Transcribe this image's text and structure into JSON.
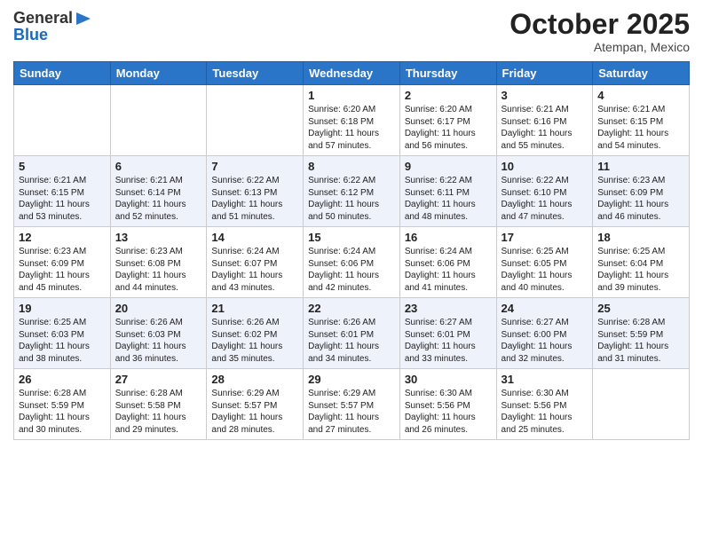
{
  "header": {
    "logo_general": "General",
    "logo_blue": "Blue",
    "month": "October 2025",
    "location": "Atempan, Mexico"
  },
  "days_of_week": [
    "Sunday",
    "Monday",
    "Tuesday",
    "Wednesday",
    "Thursday",
    "Friday",
    "Saturday"
  ],
  "weeks": [
    [
      {
        "num": "",
        "info": ""
      },
      {
        "num": "",
        "info": ""
      },
      {
        "num": "",
        "info": ""
      },
      {
        "num": "1",
        "info": "Sunrise: 6:20 AM\nSunset: 6:18 PM\nDaylight: 11 hours\nand 57 minutes."
      },
      {
        "num": "2",
        "info": "Sunrise: 6:20 AM\nSunset: 6:17 PM\nDaylight: 11 hours\nand 56 minutes."
      },
      {
        "num": "3",
        "info": "Sunrise: 6:21 AM\nSunset: 6:16 PM\nDaylight: 11 hours\nand 55 minutes."
      },
      {
        "num": "4",
        "info": "Sunrise: 6:21 AM\nSunset: 6:15 PM\nDaylight: 11 hours\nand 54 minutes."
      }
    ],
    [
      {
        "num": "5",
        "info": "Sunrise: 6:21 AM\nSunset: 6:15 PM\nDaylight: 11 hours\nand 53 minutes."
      },
      {
        "num": "6",
        "info": "Sunrise: 6:21 AM\nSunset: 6:14 PM\nDaylight: 11 hours\nand 52 minutes."
      },
      {
        "num": "7",
        "info": "Sunrise: 6:22 AM\nSunset: 6:13 PM\nDaylight: 11 hours\nand 51 minutes."
      },
      {
        "num": "8",
        "info": "Sunrise: 6:22 AM\nSunset: 6:12 PM\nDaylight: 11 hours\nand 50 minutes."
      },
      {
        "num": "9",
        "info": "Sunrise: 6:22 AM\nSunset: 6:11 PM\nDaylight: 11 hours\nand 48 minutes."
      },
      {
        "num": "10",
        "info": "Sunrise: 6:22 AM\nSunset: 6:10 PM\nDaylight: 11 hours\nand 47 minutes."
      },
      {
        "num": "11",
        "info": "Sunrise: 6:23 AM\nSunset: 6:09 PM\nDaylight: 11 hours\nand 46 minutes."
      }
    ],
    [
      {
        "num": "12",
        "info": "Sunrise: 6:23 AM\nSunset: 6:09 PM\nDaylight: 11 hours\nand 45 minutes."
      },
      {
        "num": "13",
        "info": "Sunrise: 6:23 AM\nSunset: 6:08 PM\nDaylight: 11 hours\nand 44 minutes."
      },
      {
        "num": "14",
        "info": "Sunrise: 6:24 AM\nSunset: 6:07 PM\nDaylight: 11 hours\nand 43 minutes."
      },
      {
        "num": "15",
        "info": "Sunrise: 6:24 AM\nSunset: 6:06 PM\nDaylight: 11 hours\nand 42 minutes."
      },
      {
        "num": "16",
        "info": "Sunrise: 6:24 AM\nSunset: 6:06 PM\nDaylight: 11 hours\nand 41 minutes."
      },
      {
        "num": "17",
        "info": "Sunrise: 6:25 AM\nSunset: 6:05 PM\nDaylight: 11 hours\nand 40 minutes."
      },
      {
        "num": "18",
        "info": "Sunrise: 6:25 AM\nSunset: 6:04 PM\nDaylight: 11 hours\nand 39 minutes."
      }
    ],
    [
      {
        "num": "19",
        "info": "Sunrise: 6:25 AM\nSunset: 6:03 PM\nDaylight: 11 hours\nand 38 minutes."
      },
      {
        "num": "20",
        "info": "Sunrise: 6:26 AM\nSunset: 6:03 PM\nDaylight: 11 hours\nand 36 minutes."
      },
      {
        "num": "21",
        "info": "Sunrise: 6:26 AM\nSunset: 6:02 PM\nDaylight: 11 hours\nand 35 minutes."
      },
      {
        "num": "22",
        "info": "Sunrise: 6:26 AM\nSunset: 6:01 PM\nDaylight: 11 hours\nand 34 minutes."
      },
      {
        "num": "23",
        "info": "Sunrise: 6:27 AM\nSunset: 6:01 PM\nDaylight: 11 hours\nand 33 minutes."
      },
      {
        "num": "24",
        "info": "Sunrise: 6:27 AM\nSunset: 6:00 PM\nDaylight: 11 hours\nand 32 minutes."
      },
      {
        "num": "25",
        "info": "Sunrise: 6:28 AM\nSunset: 5:59 PM\nDaylight: 11 hours\nand 31 minutes."
      }
    ],
    [
      {
        "num": "26",
        "info": "Sunrise: 6:28 AM\nSunset: 5:59 PM\nDaylight: 11 hours\nand 30 minutes."
      },
      {
        "num": "27",
        "info": "Sunrise: 6:28 AM\nSunset: 5:58 PM\nDaylight: 11 hours\nand 29 minutes."
      },
      {
        "num": "28",
        "info": "Sunrise: 6:29 AM\nSunset: 5:57 PM\nDaylight: 11 hours\nand 28 minutes."
      },
      {
        "num": "29",
        "info": "Sunrise: 6:29 AM\nSunset: 5:57 PM\nDaylight: 11 hours\nand 27 minutes."
      },
      {
        "num": "30",
        "info": "Sunrise: 6:30 AM\nSunset: 5:56 PM\nDaylight: 11 hours\nand 26 minutes."
      },
      {
        "num": "31",
        "info": "Sunrise: 6:30 AM\nSunset: 5:56 PM\nDaylight: 11 hours\nand 25 minutes."
      },
      {
        "num": "",
        "info": ""
      }
    ]
  ]
}
